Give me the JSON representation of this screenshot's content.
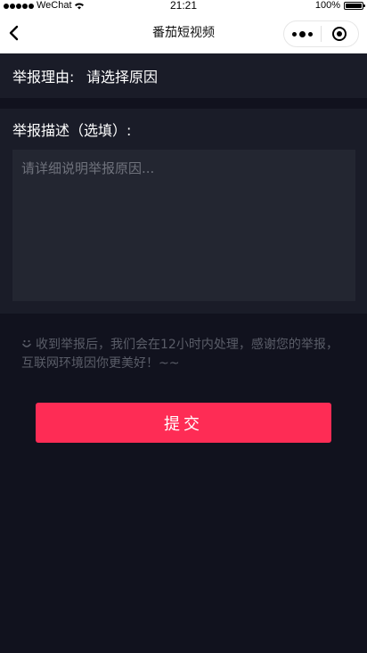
{
  "status_bar": {
    "carrier": "WeChat",
    "time": "21:21",
    "battery": "100%"
  },
  "nav": {
    "title": "番茄短视频"
  },
  "form": {
    "reason_label": "举报理由:",
    "reason_value": "请选择原因",
    "description_label": "举报描述（选填）:",
    "description_placeholder": "请详细说明举报原因..."
  },
  "notice": {
    "text": "收到举报后，我们会在12小时内处理，感谢您的举报，互联网环境因你更美好！~~"
  },
  "submit": {
    "label": "提交"
  }
}
